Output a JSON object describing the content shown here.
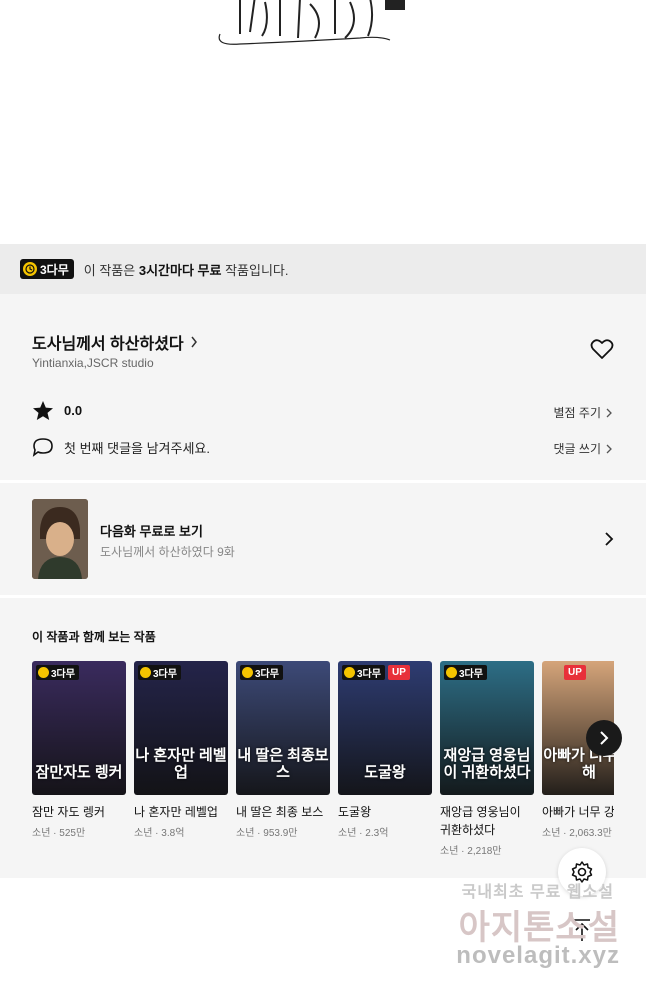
{
  "hero": {
    "logo_alt": ""
  },
  "banner": {
    "badge": "3다무",
    "text_prefix": "이 작품은 ",
    "text_bold": "3시간마다 무료",
    "text_suffix": " 작품입니다."
  },
  "work": {
    "title": "도사님께서 하산하셨다",
    "author": "Yintianxia,JSCR studio",
    "rating": "0.0",
    "rate_link": "별점 주기",
    "comment_prompt": "첫 번째 댓글을 남겨주세요.",
    "comment_link": "댓글 쓰기"
  },
  "next_episode": {
    "title": "다음화 무료로 보기",
    "subtitle": "도사님께서 하산하였다 9화"
  },
  "recommendations": {
    "heading": "이 작품과 함께 보는 작품",
    "items": [
      {
        "name": "잠만 자도 렝커",
        "meta": "소년 · 525만",
        "badge": "3다무",
        "up": "",
        "cover_text": "잠만자도 렝커",
        "color": "#3a2b5e"
      },
      {
        "name": "나 혼자만 레벨업",
        "meta": "소년 · 3.8억",
        "badge": "3다무",
        "up": "",
        "cover_text": "나 혼자만 레벨업",
        "color": "#24244a"
      },
      {
        "name": "내 딸은 최종 보스",
        "meta": "소년 · 953.9만",
        "badge": "3다무",
        "up": "",
        "cover_text": "내 딸은 최종보스",
        "color": "#3d4a78"
      },
      {
        "name": "도굴왕",
        "meta": "소년 · 2.3억",
        "badge": "3다무",
        "up": "UP",
        "cover_text": "도굴왕",
        "color": "#2e3c72"
      },
      {
        "name": "재앙급 영웅님이 귀환하셨다",
        "meta": "소년 · 2,218만",
        "badge": "3다무",
        "up": "",
        "cover_text": "재앙급 영웅님이 귀환하셨다",
        "color": "#2d6e86"
      },
      {
        "name": "아빠가 너무 강함",
        "meta": "소년 · 2,063.3만",
        "badge": "",
        "up": "UP",
        "cover_text": "아빠가 너무 강해",
        "color": "#d5a57a"
      }
    ]
  },
  "watermark": {
    "line1": "국내최초 무료 웹소설",
    "line2": "아지톤소설",
    "line3": "novelagit.xyz"
  }
}
